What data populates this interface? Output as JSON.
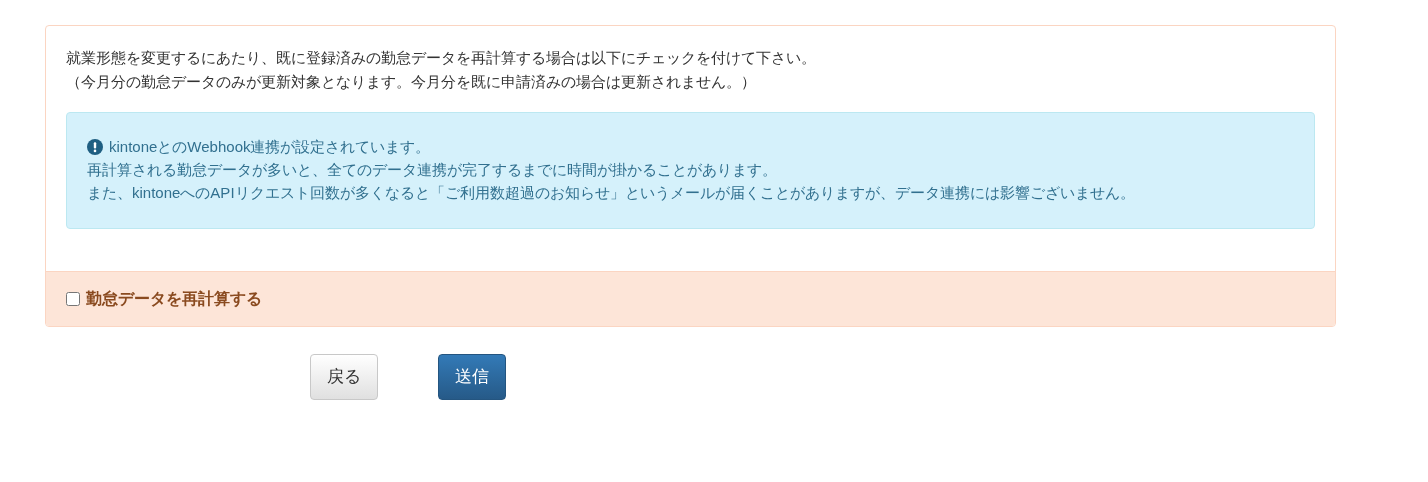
{
  "intro": [
    "就業形態を変更するにあたり、既に登録済みの勤怠データを再計算する場合は以下にチェックを付けて下さい。",
    "（今月分の勤怠データのみが更新対象となります。今月分を既に申請済みの場合は更新されません。）"
  ],
  "alert": {
    "title": "kintoneとのWebhook連携が設定されています。",
    "lines": [
      "再計算される勤怠データが多いと、全てのデータ連携が完了するまでに時間が掛かることがあります。",
      "また、kintoneへのAPIリクエスト回数が多くなると「ご利用数超過のお知らせ」というメールが届くことがありますが、データ連携には影響ございません。"
    ]
  },
  "recalculate": {
    "label": "勤怠データを再計算する",
    "checked": false
  },
  "buttons": [
    {
      "label": "戻る",
      "kind": "default"
    },
    {
      "label": "送信",
      "kind": "primary"
    }
  ]
}
